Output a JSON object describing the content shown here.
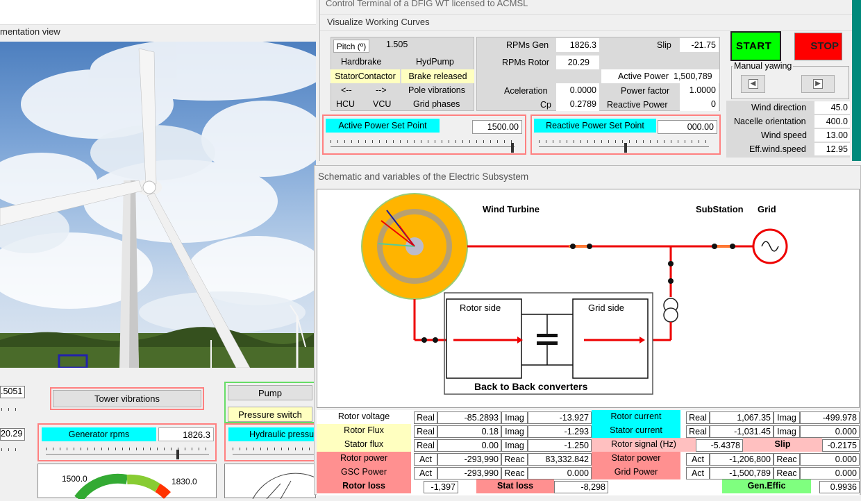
{
  "colors": {
    "start": "#00ff00",
    "stop": "#ff0000",
    "cyan": "#00ffff",
    "yellow": "#ffffc0",
    "pink": "#ff9090",
    "orange": "#ffb400"
  },
  "left_window": {
    "title": "mentation view",
    "field_a": ".5051",
    "field_b": "20.29",
    "tower_btn": "Tower vibrations",
    "gen_rpm_label": "Generator rpms",
    "gen_rpm_value": "1826.3",
    "pump_btn": "Pump",
    "pressure_btn": "Pressure switch",
    "hydraulic_label": "Hydraulic pressu",
    "gauge_min": "1500.0",
    "gauge_max": "1830.0"
  },
  "control": {
    "title": "Control Terminal of a DFIG WT licensed to ACMSL",
    "menu": "Visualize Working Curves",
    "pitch_label": "Pitch (º)",
    "pitch_value": "1.505",
    "hardbrake": "Hardbrake",
    "hydpump": "HydPump",
    "stator_contactor": "StatorContactor",
    "brake_released": "Brake released",
    "arrow_left": "<--",
    "arrow_right": "-->",
    "pole_vibrations": "Pole vibrations",
    "hcu": "HCU",
    "vcu": "VCU",
    "grid_phases": "Grid phases",
    "rpms_gen_label": "RPMs Gen",
    "rpms_gen_value": "1826.3",
    "rpms_rotor_label": "RPMs Rotor",
    "rpms_rotor_value": "20.29",
    "accel_label": "Aceleration",
    "accel_value": "0.0000",
    "cp_label": "Cp",
    "cp_value": "0.2789",
    "slip_label": "Slip",
    "slip_value": "-21.75",
    "active_power_label": "Active Power",
    "active_power_value": "1,500,789",
    "power_factor_label": "Power factor",
    "power_factor_value": "1.0000",
    "reactive_power_label": "Reactive Power",
    "reactive_power_value": "0",
    "start": "START",
    "stop": "STOP",
    "manual_yawing": "Manual yawing",
    "wind_dir_label": "Wind direction",
    "wind_dir_value": "45.0",
    "nacelle_label": "Nacelle orientation",
    "nacelle_value": "400.0",
    "wind_speed_label": "Wind speed",
    "wind_speed_value": "13.00",
    "eff_wind_label": "Eff.wind.speed",
    "eff_wind_value": "12.95",
    "aps_label": "Active Power Set Point",
    "aps_value": "1500.00",
    "aps_level": 0.98,
    "rps_label": "Reactive Power Set Point",
    "rps_value": "000.00",
    "rps_level": 0.5
  },
  "schematic": {
    "title": "Schematic and variables of the Electric Subsystem",
    "wind_turbine": "Wind Turbine",
    "substation": "SubStation",
    "grid": "Grid",
    "rotor_side": "Rotor side",
    "grid_side": "Grid side",
    "b2b": "Back to Back converters"
  },
  "table": {
    "rotor_voltage": {
      "label": "Rotor voltage",
      "tag1": "Real",
      "v1": "-85.2893",
      "tag2": "Imag",
      "v2": "-13.927"
    },
    "rotor_flux": {
      "label": "Rotor Flux",
      "tag1": "Real",
      "v1": "0.18",
      "tag2": "Imag",
      "v2": "-1.293"
    },
    "stator_flux": {
      "label": "Stator flux",
      "tag1": "Real",
      "v1": "0.00",
      "tag2": "Imag",
      "v2": "-1.250"
    },
    "rotor_power": {
      "label": "Rotor power",
      "tag1": "Act",
      "v1": "-293,990",
      "tag2": "Reac",
      "v2": "83,332.842"
    },
    "gsc_power": {
      "label": "GSC Power",
      "tag1": "Act",
      "v1": "-293,990",
      "tag2": "Reac",
      "v2": "0.000"
    },
    "rotor_loss": {
      "label": "Rotor loss",
      "v": "-1,397"
    },
    "stat_loss": {
      "label": "Stat loss",
      "v": "-8,298"
    },
    "rotor_current": {
      "label": "Rotor current",
      "tag1": "Real",
      "v1": "1,067.35",
      "tag2": "Imag",
      "v2": "-499.978"
    },
    "stator_current": {
      "label": "Stator current",
      "tag1": "Real",
      "v1": "-1,031.45",
      "tag2": "Imag",
      "v2": "0.000"
    },
    "rotor_signal": {
      "label": "Rotor signal (Hz)",
      "v": "-5.4378"
    },
    "slip": {
      "label": "Slip",
      "v": "-0.2175"
    },
    "stator_power": {
      "label": "Stator power",
      "tag1": "Act",
      "v1": "-1,206,800",
      "tag2": "Reac",
      "v2": "0.000"
    },
    "grid_power": {
      "label": "Grid Power",
      "tag1": "Act",
      "v1": "-1,500,789",
      "tag2": "Reac",
      "v2": "0.000"
    },
    "gen_effic": {
      "label": "Gen.Effic",
      "v": "0.9936"
    }
  }
}
